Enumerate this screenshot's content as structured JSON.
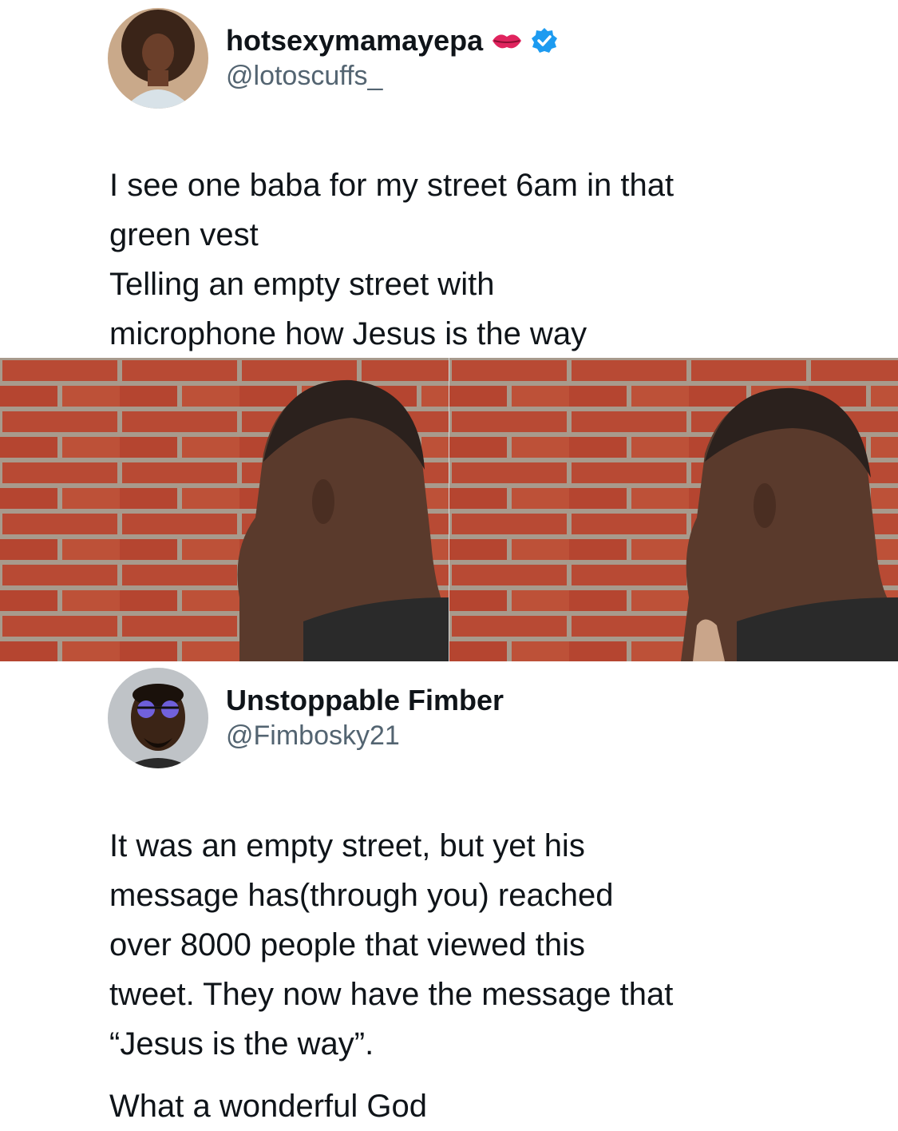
{
  "tweet1": {
    "display_name": "hotsexymamayepa",
    "handle": "@lotoscuffs_",
    "lines": [
      "I see one baba for my street 6am in that",
      "green vest",
      "Telling an empty street with",
      "microphone how Jesus is the way"
    ],
    "verified": true,
    "emoji": "kiss-mark-icon"
  },
  "media": {
    "description_icon": "meme-image-man-turning-head-at-brick-wall",
    "panels": 2,
    "colors": {
      "brick": "#b84a34",
      "mortar": "#a89a8c",
      "skin": "#5a3a2c",
      "shirt": "#2a2a2a"
    }
  },
  "tweet2": {
    "display_name": "Unstoppable Fimber",
    "handle": "@Fimbosky21",
    "paragraph1": [
      "It was an empty street, but yet his",
      "message has(through you) reached",
      "over 8000 people that viewed this",
      "tweet. They now have the message that",
      "“Jesus is the way”."
    ],
    "paragraph2": "What a wonderful God"
  },
  "colors": {
    "text": "#0f1419",
    "handle": "#536471",
    "verified": "#1d9bf0",
    "kiss": "#e0245e"
  }
}
